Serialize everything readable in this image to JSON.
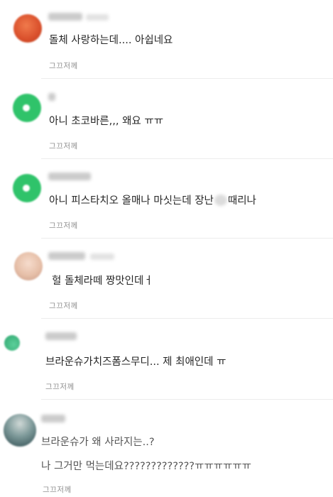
{
  "comments": [
    {
      "text": "돌체 사랑하는데.... 아쉽네요",
      "report_label": "그끄저께",
      "avatar_color": "#e2613a"
    },
    {
      "text": "아니 초코바른,,, 왜요 ㅠㅠ",
      "report_label": "그끄저께",
      "avatar_color": "#2fc36a"
    },
    {
      "text_before": "아니 피스타치오 올매나 마싯는데 장난",
      "text_after": "때리나",
      "report_label": "그끄저께",
      "avatar_color": "#2fc36a"
    },
    {
      "text": "헐 돌체라떼 짱맛인데ㅓ",
      "report_label": "그끄저께",
      "avatar_color": "#e8c4b2"
    },
    {
      "text": "브라운슈가치즈폼스무디... 제 최애인데 ㅠ",
      "report_label": "그끄저께",
      "avatar_color": "#4cc38b"
    },
    {
      "text_line1": "브라운슈가 왜 사라지는..?",
      "text_line2": "나 그거만 먹는데요?????????????ㅠㅠㅠㅠㅠㅠ",
      "report_label": "그끄저께",
      "avatar_color": "#3d5e62"
    }
  ]
}
